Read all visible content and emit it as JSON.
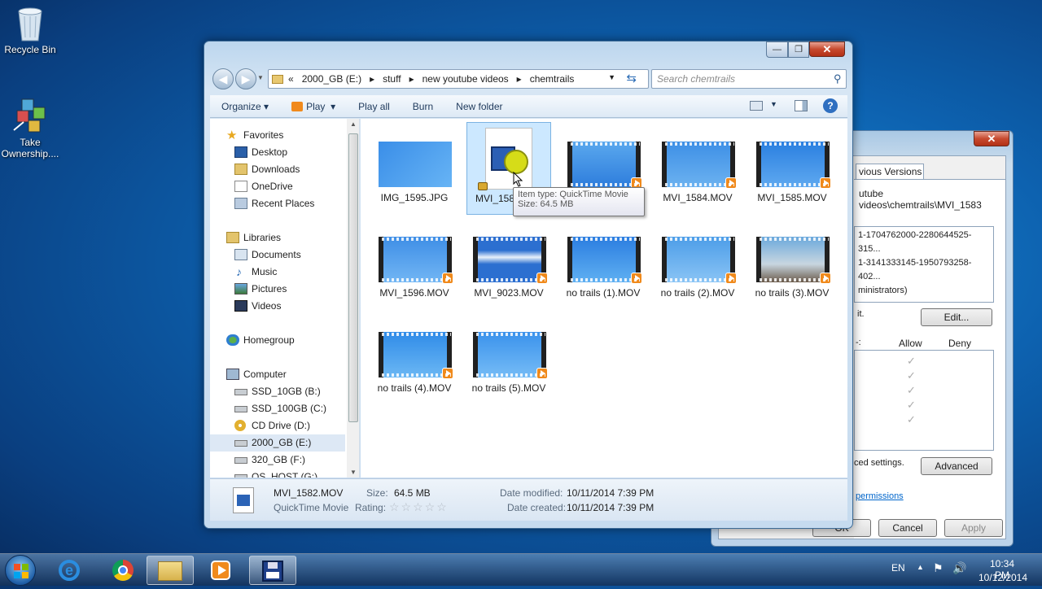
{
  "desktop": {
    "recycle_bin": "Recycle Bin",
    "take_ownership_line1": "Take",
    "take_ownership_line2": "Ownership...."
  },
  "dialog": {
    "tab": "vious Versions",
    "object_path": "utube videos\\chemtrails\\MVI_1583",
    "sids": [
      "1-1704762000-2280644525-315...",
      "1-3141333145-1950793258-402...",
      "ministrators)"
    ],
    "edit_hint": "it.",
    "edit_button": "Edit...",
    "perm_allow": "Allow",
    "perm_deny": "Deny",
    "perm_prefix": "-:",
    "advanced_hint": "ced settings.",
    "advanced_button": "Advanced",
    "permissions_link": "permissions",
    "ok_button": "OK",
    "cancel_button": "Cancel",
    "apply_button": "Apply"
  },
  "explorer": {
    "breadcrumb": [
      "«",
      "2000_GB (E:)",
      "stuff",
      "new youtube videos",
      "chemtrails"
    ],
    "search_placeholder": "Search chemtrails",
    "toolbar": {
      "organize": "Organize",
      "play": "Play",
      "play_all": "Play all",
      "burn": "Burn",
      "new_folder": "New folder"
    },
    "nav": {
      "favorites": "Favorites",
      "fav_items": [
        "Desktop",
        "Downloads",
        "OneDrive",
        "Recent Places"
      ],
      "libraries": "Libraries",
      "lib_items": [
        "Documents",
        "Music",
        "Pictures",
        "Videos"
      ],
      "homegroup": "Homegroup",
      "computer": "Computer",
      "drives": [
        "SSD_10GB (B:)",
        "SSD_100GB (C:)",
        "CD Drive (D:)",
        "2000_GB (E:)",
        "320_GB (F:)",
        "OS_HOST (G:)"
      ]
    },
    "files": [
      "IMG_1595.JPG",
      "MVI_158",
      "",
      "MVI_1584.MOV",
      "MVI_1585.MOV",
      "MVI_1596.MOV",
      "MVI_9023.MOV",
      "no trails (1).MOV",
      "no trails (2).MOV",
      "no trails (3).MOV",
      "no trails (4).MOV",
      "no trails (5).MOV"
    ],
    "tooltip": {
      "type": "Item type: QuickTime Movie",
      "size": "Size: 64.5 MB"
    },
    "details": {
      "name": "MVI_1582.MOV",
      "type": "QuickTime Movie",
      "size_label": "Size:",
      "size": "64.5 MB",
      "rating_label": "Rating:",
      "rating": 0,
      "modified_label": "Date modified:",
      "modified": "10/11/2014 7:39 PM",
      "created_label": "Date created:",
      "created": "10/11/2014 7:39 PM"
    }
  },
  "taskbar": {
    "lang": "EN",
    "time": "10:34 PM",
    "date": "10/12/2014"
  },
  "colors": {
    "accent": "#3399ff",
    "play_badge": "#f08a1c",
    "close_red": "#c74a2f"
  }
}
